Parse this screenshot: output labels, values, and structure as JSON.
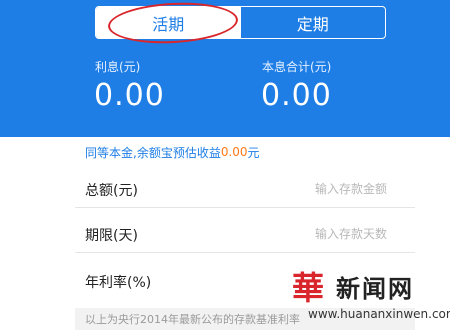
{
  "tabs": [
    {
      "label": "活期",
      "active": true
    },
    {
      "label": "定期",
      "active": false
    }
  ],
  "stats": {
    "interest_label": "利息(元)",
    "interest_value": "0.00",
    "total_label": "本息合计(元)",
    "total_value": "0.00"
  },
  "hint": {
    "prefix": "同等本金,余额宝预估收益",
    "amount": "0.00",
    "suffix": "元"
  },
  "form": {
    "amount_label": "总额(元)",
    "amount_placeholder": "输入存款金额",
    "term_label": "期限(天)",
    "term_placeholder": "输入存款天数",
    "rate_label": "年利率(%)"
  },
  "footnote": "以上为央行2014年最新公布的存款基准利率",
  "watermark": {
    "logo_char": "華",
    "title": "新闻网",
    "url": "www.huananxinwen.com"
  },
  "colors": {
    "primary": "#1f7ee6",
    "accent": "#ff7a1a",
    "annotation": "#d9262c"
  }
}
